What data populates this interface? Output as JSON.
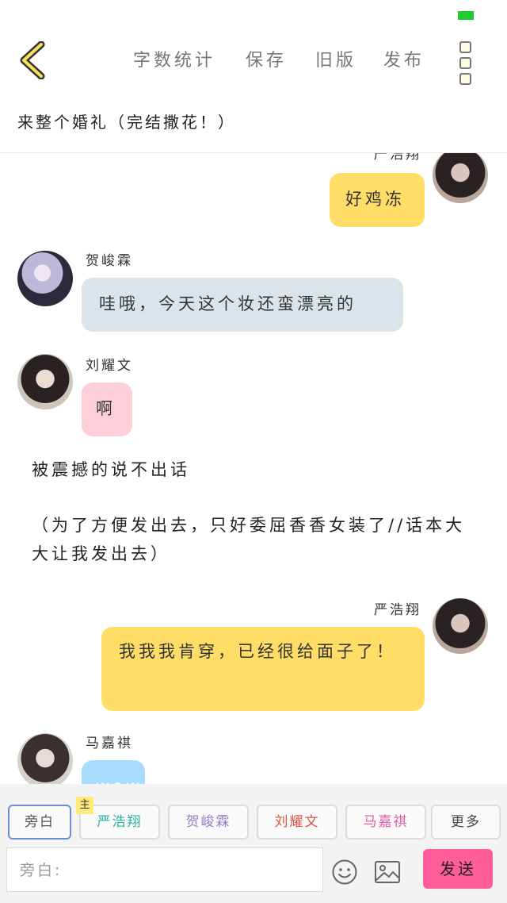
{
  "header": {
    "menu": [
      "字数统计",
      "保存",
      "旧版",
      "发布"
    ],
    "title": "来整个婚礼（完结撒花！）"
  },
  "colors": {
    "status": "#1fcc2e",
    "accent_send": "#ff5d9a",
    "yellow_bubble": "#ffdd66"
  },
  "chat": {
    "top_partial_name": "严浩翔",
    "messages": [
      {
        "side": "right",
        "name": "严浩翔",
        "text": "好鸡冻"
      },
      {
        "side": "left",
        "name": "贺峻霖",
        "text": "哇哦，今天这个妆还蛮漂亮的"
      },
      {
        "side": "left",
        "name": "刘耀文",
        "text": "啊"
      },
      {
        "narration": "被震撼的说不出话"
      },
      {
        "narration": "（为了方便发出去，只好委屈香香女装了//话本大大让我发出去）"
      },
      {
        "side": "right",
        "name": "严浩翔",
        "text": "我我我肯穿，已经很给面子了！"
      },
      {
        "side": "left",
        "name": "马嘉祺",
        "text": "wow"
      }
    ]
  },
  "bottom": {
    "chips": [
      "旁白",
      "严浩翔",
      "贺峻霖",
      "刘耀文",
      "马嘉祺",
      "更多"
    ],
    "main_badge": "主",
    "input_placeholder": "旁白:",
    "send_label": "发送",
    "icons": [
      "emoji-icon",
      "image-icon"
    ]
  }
}
